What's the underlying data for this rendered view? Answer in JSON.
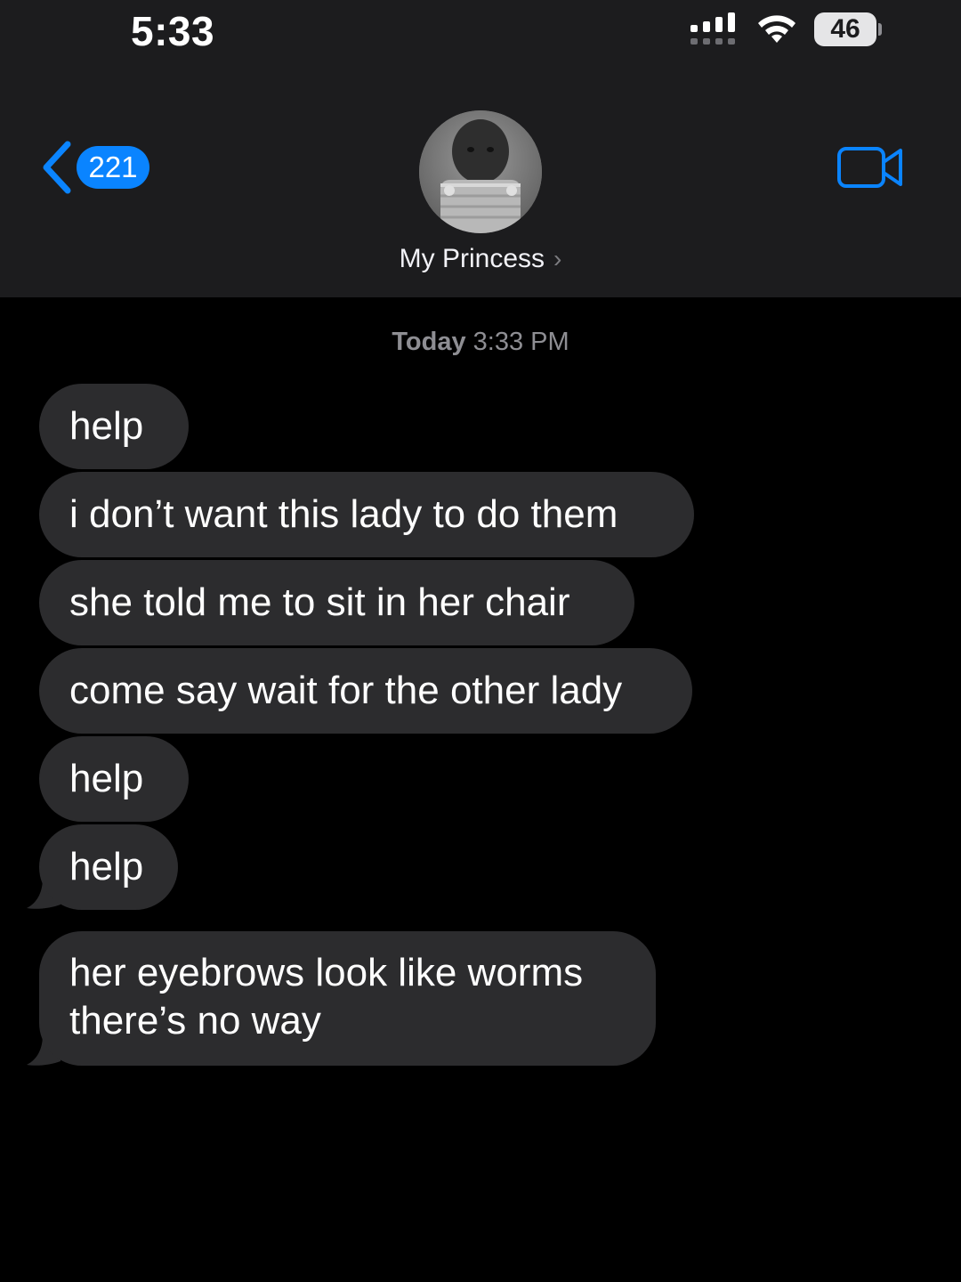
{
  "status_bar": {
    "time": "5:33",
    "battery": "46",
    "signal_icon": "signal-icon",
    "wifi_icon": "wifi-icon"
  },
  "header": {
    "back_count": "221",
    "contact_name": "My Princess",
    "chevron": "›",
    "video_icon": "video-camera-icon",
    "accent_color": "#0a84ff"
  },
  "conversation": {
    "timestamp_day": "Today",
    "timestamp_time": "3:33 PM",
    "messages": [
      {
        "text": "help"
      },
      {
        "text": "i don’t want this lady to do them"
      },
      {
        "text": "she told me to sit in her chair"
      },
      {
        "text": "come say wait for the other lady"
      },
      {
        "text": "help"
      },
      {
        "text": "help"
      },
      {
        "text_line1": "her eyebrows look like worms",
        "text_line2": "there’s no way"
      }
    ]
  }
}
